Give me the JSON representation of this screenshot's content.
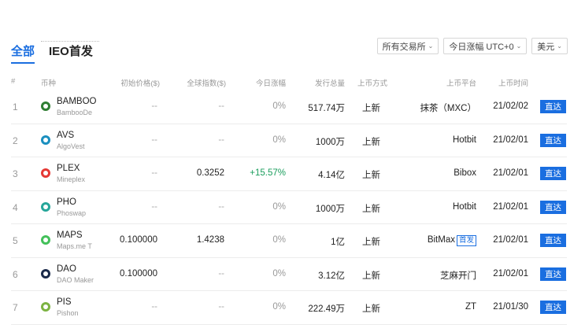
{
  "tabs": {
    "all": "全部",
    "ieo": "IEO首发"
  },
  "filters": [
    {
      "label": "所有交易所"
    },
    {
      "label": "今日涨幅 UTC+0"
    },
    {
      "label": "美元"
    }
  ],
  "headers": {
    "idx": "#",
    "coin": "币种",
    "init_price": "初始价格($)",
    "global_index": "全球指数($)",
    "change": "今日涨幅",
    "supply": "发行总量",
    "method": "上币方式",
    "platform": "上币平台",
    "time": "上币时间"
  },
  "rows": [
    {
      "idx": "1",
      "symbol": "BAMBOO",
      "name": "BambooDe",
      "init": "--",
      "global": "--",
      "change": "0%",
      "change_up": false,
      "supply": "517.74万",
      "method": "上新",
      "platform": "抹茶（MXC）",
      "badge": "",
      "date": "21/02/02",
      "action": "直达",
      "icon": "bamboo-icon",
      "color": "#2e7d32"
    },
    {
      "idx": "2",
      "symbol": "AVS",
      "name": "AlgoVest",
      "init": "--",
      "global": "--",
      "change": "0%",
      "change_up": false,
      "supply": "1000万",
      "method": "上新",
      "platform": "Hotbit",
      "badge": "",
      "date": "21/02/01",
      "action": "直达",
      "icon": "wave-icon",
      "color": "#1a8fbf"
    },
    {
      "idx": "3",
      "symbol": "PLEX",
      "name": "Mineplex",
      "init": "--",
      "global": "0.3252",
      "change": "+15.57%",
      "change_up": true,
      "supply": "4.14亿",
      "method": "上新",
      "platform": "Bibox",
      "badge": "",
      "date": "21/02/01",
      "action": "直达",
      "icon": "plex-icon",
      "color": "#e53935"
    },
    {
      "idx": "4",
      "symbol": "PHO",
      "name": "Phoswap",
      "init": "--",
      "global": "--",
      "change": "0%",
      "change_up": false,
      "supply": "1000万",
      "method": "上新",
      "platform": "Hotbit",
      "badge": "",
      "date": "21/02/01",
      "action": "直达",
      "icon": "pho-icon",
      "color": "#26a69a"
    },
    {
      "idx": "5",
      "symbol": "MAPS",
      "name": "Maps.me T",
      "init": "0.100000",
      "global": "1.4238",
      "change": "0%",
      "change_up": false,
      "supply": "1亿",
      "method": "上新",
      "platform": "BitMax",
      "badge": "首发",
      "date": "21/02/01",
      "action": "直达",
      "icon": "maps-icon",
      "color": "#43c05a"
    },
    {
      "idx": "6",
      "symbol": "DAO",
      "name": "DAO Maker",
      "init": "0.100000",
      "global": "--",
      "change": "0%",
      "change_up": false,
      "supply": "3.12亿",
      "method": "上新",
      "platform": "芝麻开门",
      "badge": "",
      "date": "21/02/01",
      "action": "直达",
      "icon": "dao-icon",
      "color": "#1a2a4a"
    },
    {
      "idx": "7",
      "symbol": "PIS",
      "name": "Pishon",
      "init": "--",
      "global": "--",
      "change": "0%",
      "change_up": false,
      "supply": "222.49万",
      "method": "上新",
      "platform": "ZT",
      "badge": "",
      "date": "21/01/30",
      "action": "直达",
      "icon": "leaf-icon",
      "color": "#7cb342"
    }
  ]
}
